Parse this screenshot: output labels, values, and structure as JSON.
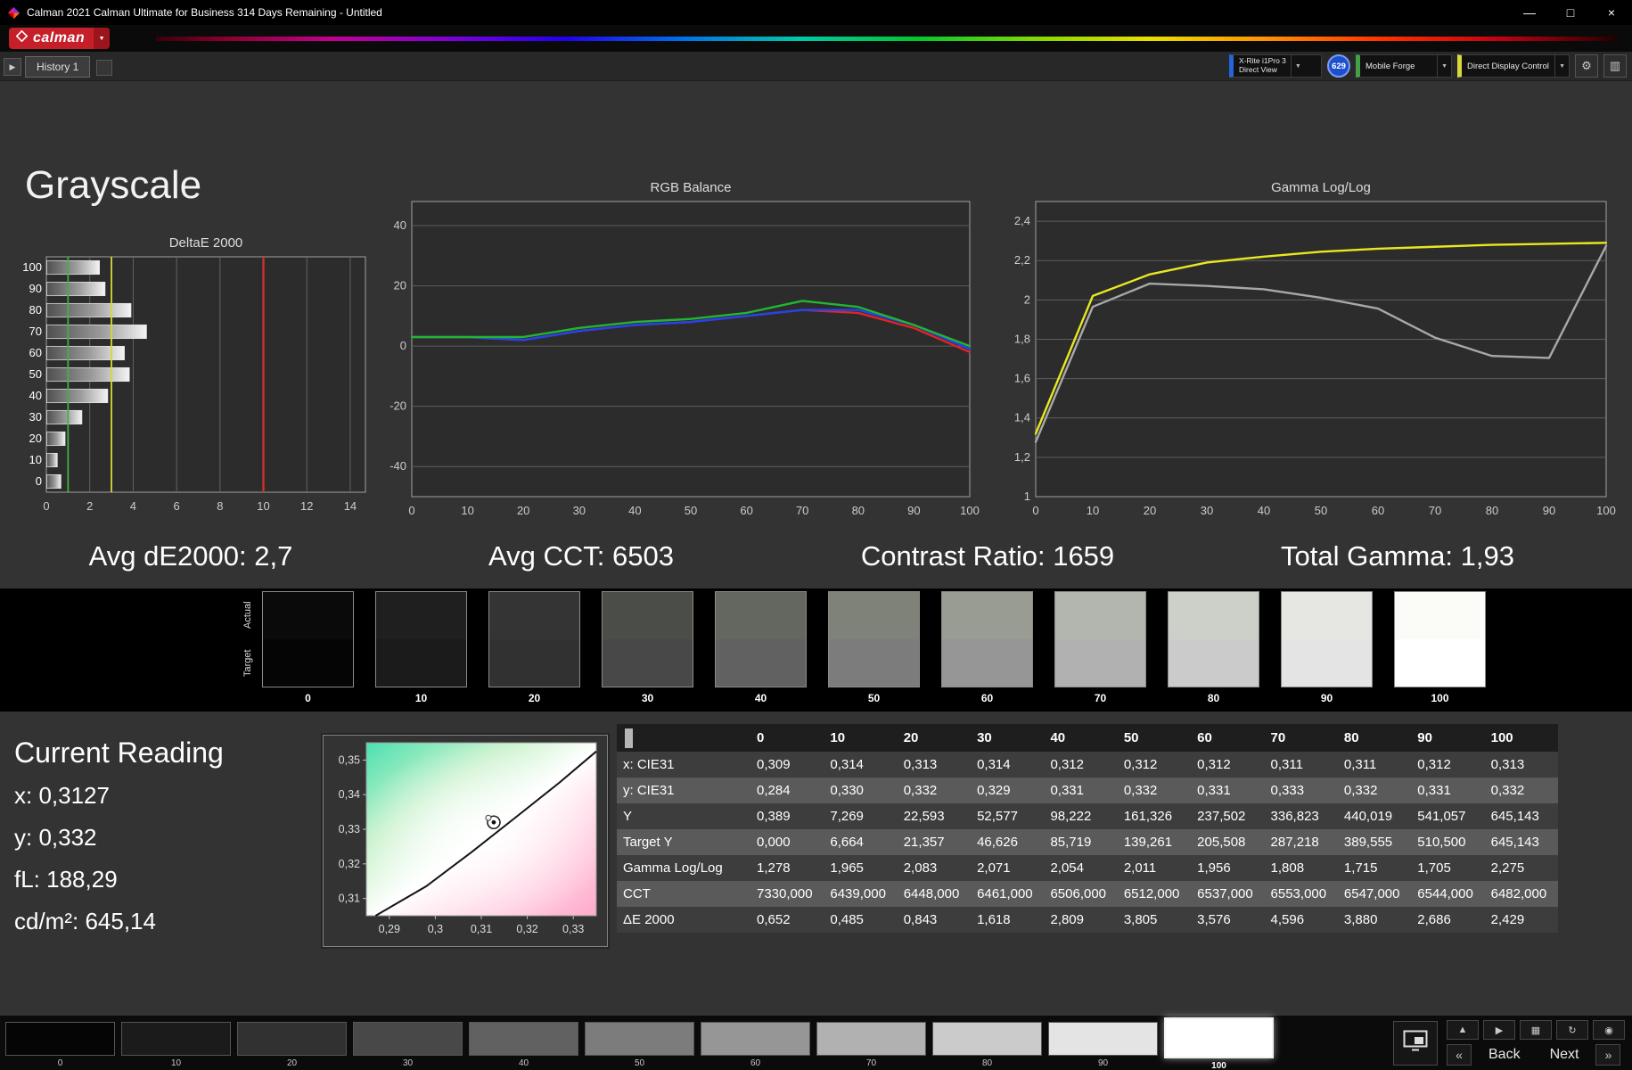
{
  "window": {
    "title": "Calman 2021 Calman Ultimate for Business 314 Days Remaining  - Untitled"
  },
  "logo": {
    "text": "calman"
  },
  "tabs": {
    "history_label": "History 1"
  },
  "icons": {
    "minimize": "—",
    "maximize": "□",
    "close": "×",
    "caret": "▼",
    "expander": "▶",
    "gear": "⚙",
    "grid": "▥",
    "eject": "▲",
    "play": "▶",
    "save": "▦",
    "sync": "↻",
    "power": "◉",
    "back_chev": "«",
    "next_chev": "»"
  },
  "meter_bar": {
    "meter": {
      "line1": "X-Rite i1Pro 3",
      "line2": "Direct View",
      "accent": "#2563d8"
    },
    "badge": "629",
    "source": {
      "label": "Mobile Forge",
      "accent": "#43a047"
    },
    "display": {
      "label": "Direct Display Control",
      "accent": "#d8d83a"
    }
  },
  "page": {
    "title": "Grayscale"
  },
  "summary_stats": [
    "Avg dE2000: 2,7",
    "Avg CCT: 6503",
    "Contrast Ratio: 1659",
    "Total Gamma: 1,93"
  ],
  "chart_data": [
    {
      "type": "bar",
      "title": "DeltaE 2000",
      "orientation": "horizontal",
      "categories": [
        "100",
        "90",
        "80",
        "70",
        "60",
        "50",
        "40",
        "30",
        "20",
        "10",
        "0"
      ],
      "values": [
        2.429,
        2.686,
        3.88,
        4.596,
        3.576,
        3.805,
        2.809,
        1.618,
        0.843,
        0.485,
        0.652
      ],
      "xlim": [
        0,
        14.7
      ],
      "xticks": [
        0,
        2,
        4,
        6,
        8,
        10,
        12,
        14
      ],
      "reference_lines": [
        {
          "x": 1,
          "color": "#3db53d"
        },
        {
          "x": 3,
          "color": "#d6d63a"
        },
        {
          "x": 10,
          "color": "#d03030"
        }
      ]
    },
    {
      "type": "line",
      "title": "RGB Balance",
      "x": [
        0,
        10,
        20,
        30,
        40,
        50,
        60,
        70,
        80,
        90,
        100
      ],
      "xticks": [
        0,
        10,
        20,
        30,
        40,
        50,
        60,
        70,
        80,
        90,
        100
      ],
      "ylim": [
        -50,
        48
      ],
      "yticks": [
        40,
        20,
        0,
        -20,
        -40
      ],
      "ytick_labels": [
        "40",
        "20",
        "0",
        "-20",
        "-40"
      ],
      "series": [
        {
          "name": "Red",
          "color": "#e02525",
          "values": [
            3,
            3,
            2,
            5,
            7,
            8,
            10,
            12,
            11,
            6,
            -2
          ]
        },
        {
          "name": "Blue",
          "color": "#2244ee",
          "values": [
            3,
            3,
            2,
            5,
            7,
            8,
            10,
            12,
            12,
            7,
            -1
          ]
        },
        {
          "name": "Green",
          "color": "#22b533",
          "values": [
            3,
            3,
            3,
            6,
            8,
            9,
            11,
            15,
            13,
            7,
            0
          ]
        }
      ]
    },
    {
      "type": "line",
      "title": "Gamma Log/Log",
      "x": [
        0,
        10,
        20,
        30,
        40,
        50,
        60,
        70,
        80,
        90,
        100
      ],
      "xticks": [
        0,
        10,
        20,
        30,
        40,
        50,
        60,
        70,
        80,
        90,
        100
      ],
      "ylim": [
        1,
        2.5
      ],
      "yticks": [
        2.4,
        2.2,
        2.0,
        1.8,
        1.6,
        1.4,
        1.2,
        1.0
      ],
      "ytick_labels": [
        "2,4",
        "2,2",
        "2",
        "1,8",
        "1,6",
        "1,4",
        "1,2",
        "1"
      ],
      "series": [
        {
          "name": "Measured",
          "color": "#a8a8a8",
          "values": [
            1.278,
            1.965,
            2.083,
            2.071,
            2.054,
            2.011,
            1.956,
            1.808,
            1.715,
            1.705,
            2.275
          ]
        },
        {
          "name": "Target",
          "color": "#e8e822",
          "values": [
            1.32,
            2.02,
            2.13,
            2.19,
            2.22,
            2.245,
            2.26,
            2.27,
            2.28,
            2.285,
            2.29
          ]
        }
      ]
    },
    {
      "type": "scatter",
      "title": "CIE xy chromaticity",
      "xlim": [
        0.285,
        0.335
      ],
      "ylim": [
        0.305,
        0.355
      ],
      "xticks": [
        {
          "v": 0.29,
          "l": "0,29"
        },
        {
          "v": 0.3,
          "l": "0,3"
        },
        {
          "v": 0.31,
          "l": "0,31"
        },
        {
          "v": 0.32,
          "l": "0,32"
        },
        {
          "v": 0.33,
          "l": "0,33"
        }
      ],
      "yticks": [
        {
          "v": 0.35,
          "l": "0,35"
        },
        {
          "v": 0.34,
          "l": "0,34"
        },
        {
          "v": 0.33,
          "l": "0,33"
        },
        {
          "v": 0.32,
          "l": "0,32"
        },
        {
          "v": 0.31,
          "l": "0,31"
        }
      ],
      "locus": [
        [
          0.287,
          0.305
        ],
        [
          0.298,
          0.3135
        ],
        [
          0.308,
          0.3235
        ],
        [
          0.318,
          0.334
        ],
        [
          0.327,
          0.3435
        ],
        [
          0.335,
          0.3525
        ]
      ],
      "points": [
        {
          "x": 0.3127,
          "y": 0.332,
          "name": "current-reading"
        }
      ]
    }
  ],
  "swatch_strip": {
    "row_labels": [
      "Actual",
      "Target"
    ],
    "levels": [
      {
        "label": "0",
        "actual": "#0a0a0a",
        "target": "#050505"
      },
      {
        "label": "10",
        "actual": "#1f1f1f",
        "target": "#1b1b1b"
      },
      {
        "label": "20",
        "actual": "#343434",
        "target": "#313131"
      },
      {
        "label": "30",
        "actual": "#4b4d49",
        "target": "#484848"
      },
      {
        "label": "40",
        "actual": "#64675f",
        "target": "#616161"
      },
      {
        "label": "50",
        "actual": "#7e8279",
        "target": "#7c7c7c"
      },
      {
        "label": "60",
        "actual": "#989c93",
        "target": "#969696"
      },
      {
        "label": "70",
        "actual": "#b3b6ae",
        "target": "#b1b1b1"
      },
      {
        "label": "80",
        "actual": "#cdcfc9",
        "target": "#cbcbcb"
      },
      {
        "label": "90",
        "actual": "#e6e7e3",
        "target": "#e4e4e4"
      },
      {
        "label": "100",
        "actual": "#fbfcf8",
        "target": "#ffffff"
      }
    ]
  },
  "current_reading": {
    "title": "Current Reading",
    "x": "x: 0,3127",
    "y": "y: 0,332",
    "fl": "fL: 188,29",
    "cdm2": "cd/m²: 645,14"
  },
  "table": {
    "columns": [
      "0",
      "10",
      "20",
      "30",
      "40",
      "50",
      "60",
      "70",
      "80",
      "90",
      "100"
    ],
    "rows": [
      {
        "label": "x: CIE31",
        "values": [
          "0,309",
          "0,314",
          "0,313",
          "0,314",
          "0,312",
          "0,312",
          "0,312",
          "0,311",
          "0,311",
          "0,312",
          "0,313"
        ]
      },
      {
        "label": "y: CIE31",
        "values": [
          "0,284",
          "0,330",
          "0,332",
          "0,329",
          "0,331",
          "0,332",
          "0,331",
          "0,333",
          "0,332",
          "0,331",
          "0,332"
        ]
      },
      {
        "label": "Y",
        "values": [
          "0,389",
          "7,269",
          "22,593",
          "52,577",
          "98,222",
          "161,326",
          "237,502",
          "336,823",
          "440,019",
          "541,057",
          "645,143"
        ]
      },
      {
        "label": "Target Y",
        "values": [
          "0,000",
          "6,664",
          "21,357",
          "46,626",
          "85,719",
          "139,261",
          "205,508",
          "287,218",
          "389,555",
          "510,500",
          "645,143"
        ]
      },
      {
        "label": "Gamma Log/Log",
        "values": [
          "1,278",
          "1,965",
          "2,083",
          "2,071",
          "2,054",
          "2,011",
          "1,956",
          "1,808",
          "1,715",
          "1,705",
          "2,275"
        ]
      },
      {
        "label": "CCT",
        "values": [
          "7330,000",
          "6439,000",
          "6448,000",
          "6461,000",
          "6506,000",
          "6512,000",
          "6537,000",
          "6553,000",
          "6547,000",
          "6544,000",
          "6482,000"
        ]
      },
      {
        "label": "ΔE 2000",
        "values": [
          "0,652",
          "0,485",
          "0,843",
          "1,618",
          "2,809",
          "3,805",
          "3,576",
          "4,596",
          "3,880",
          "2,686",
          "2,429"
        ]
      }
    ]
  },
  "bottom_bar": {
    "selected": "100",
    "patches": [
      {
        "label": "0",
        "color": "#050505"
      },
      {
        "label": "10",
        "color": "#1b1b1b"
      },
      {
        "label": "20",
        "color": "#313131"
      },
      {
        "label": "30",
        "color": "#484848"
      },
      {
        "label": "40",
        "color": "#616161"
      },
      {
        "label": "50",
        "color": "#7c7c7c"
      },
      {
        "label": "60",
        "color": "#969696"
      },
      {
        "label": "70",
        "color": "#b1b1b1"
      },
      {
        "label": "80",
        "color": "#cbcbcb"
      },
      {
        "label": "90",
        "color": "#e4e4e4"
      },
      {
        "label": "100",
        "color": "#ffffff"
      }
    ],
    "nav": {
      "back": "Back",
      "next": "Next"
    }
  }
}
